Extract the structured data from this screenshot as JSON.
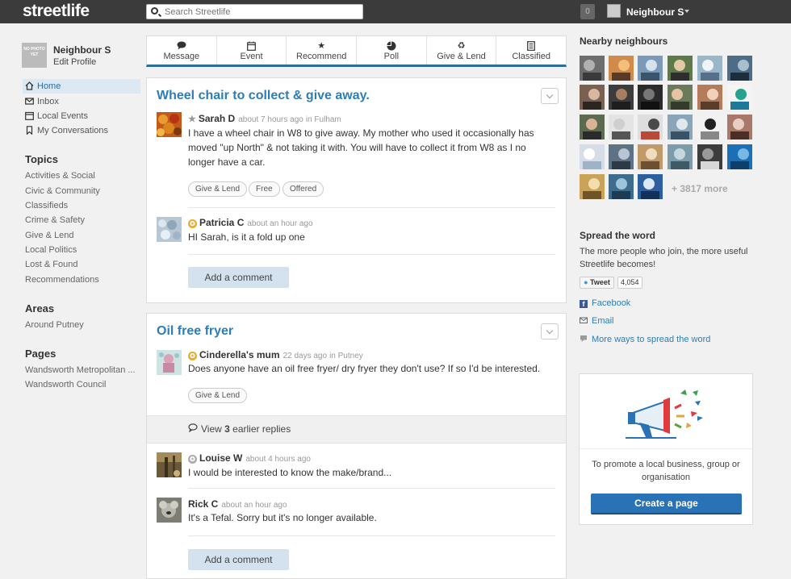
{
  "header": {
    "logo_bold": "streetlife",
    "search_placeholder": "Search Streetlife",
    "notification_count": "0",
    "user_name": "Neighbour S"
  },
  "profile": {
    "photo_text": "NO PHOTO YET",
    "name": "Neighbour S",
    "edit_label": "Edit Profile"
  },
  "nav": [
    {
      "label": "Home",
      "icon": "home-icon"
    },
    {
      "label": "Inbox",
      "icon": "mail-icon"
    },
    {
      "label": "Local Events",
      "icon": "calendar-icon"
    },
    {
      "label": "My Conversations",
      "icon": "bookmark-icon"
    }
  ],
  "topics": {
    "heading": "Topics",
    "items": [
      "Activities & Social",
      "Civic & Community",
      "Classifieds",
      "Crime & Safety",
      "Give & Lend",
      "Local Politics",
      "Lost & Found",
      "Recommendations"
    ]
  },
  "areas": {
    "heading": "Areas",
    "items": [
      "Around Putney"
    ]
  },
  "pages": {
    "heading": "Pages",
    "items": [
      "Wandsworth Metropolitan ...",
      "Wandsworth Council"
    ]
  },
  "composer": [
    {
      "label": "Message",
      "icon": "speech-bubble-icon"
    },
    {
      "label": "Event",
      "icon": "calendar-icon"
    },
    {
      "label": "Recommend",
      "icon": "star-icon"
    },
    {
      "label": "Poll",
      "icon": "pie-chart-icon"
    },
    {
      "label": "Give & Lend",
      "icon": "recycle-icon"
    },
    {
      "label": "Classified",
      "icon": "document-icon"
    }
  ],
  "posts": [
    {
      "title": "Wheel chair to collect & give away.",
      "author": "Sarah D",
      "time": "about 7 hours ago",
      "location": "in Fulham",
      "body": "I have a wheel chair in W8 to give away.  My mother who used it occasionally has moved \"up North\" & not taking it with.  You will have to collect it from W8 as I no longer have a car.",
      "tags": [
        "Give & Lend",
        "Free",
        "Offered"
      ],
      "comments": [
        {
          "author": "Patricia C",
          "time": "about an hour ago",
          "text": "HI Sarah, is it a fold up one"
        }
      ],
      "comment_button": "Add a comment"
    },
    {
      "title": "Oil free fryer",
      "author": "Cinderella's mum",
      "time": "22 days ago",
      "location": "in Putney",
      "body": "Does anyone have an oil free fryer/ dry fryer they don't use? If so I'd be interested.",
      "tags": [
        "Give & Lend"
      ],
      "earlier_prefix": "View",
      "earlier_count": "3",
      "earlier_suffix": "earlier replies",
      "comments": [
        {
          "author": "Louise W",
          "time": "about 4 hours ago",
          "text": "I would be interested to know the make/brand..."
        },
        {
          "author": "Rick C",
          "time": "about an hour ago",
          "text": "It's a Tefal. Sorry but it's no longer available."
        }
      ],
      "comment_button": "Add a comment"
    }
  ],
  "neighbours": {
    "heading": "Nearby neighbours",
    "more": "+ 3817 more"
  },
  "spread": {
    "heading": "Spread the word",
    "text": "The more people who join, the more useful Streetlife becomes!",
    "tweet_label": "Tweet",
    "tweet_count": "4,054",
    "facebook": "Facebook",
    "email": "Email",
    "more_ways": "More ways to spread the word"
  },
  "promo": {
    "text": "To promote a local business, group or organisation",
    "button": "Create a page"
  },
  "colors": {
    "accent": "#2e7db5",
    "topbar": "#3b3b3b",
    "button_primary": "#2a72b6"
  }
}
